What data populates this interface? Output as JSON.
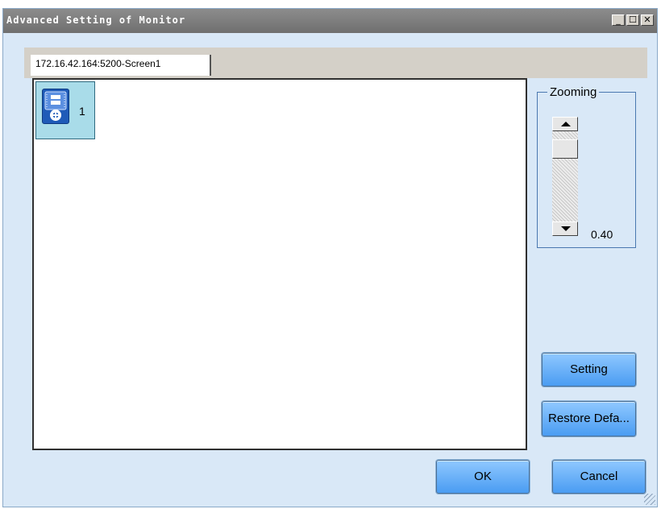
{
  "window": {
    "title": "Advanced Setting of Monitor",
    "controls": {
      "minimize": "_",
      "maximize": "☐",
      "close": "✕"
    }
  },
  "tabs": [
    {
      "label": "172.16.42.164:5200-Screen1",
      "selected": true
    }
  ],
  "screen": {
    "cabinets": [
      {
        "label": "1",
        "icon": "receiving-card-icon"
      }
    ]
  },
  "zoom": {
    "legend": "Zooming",
    "value_text": "0.40",
    "value": 0.4
  },
  "buttons": {
    "setting": "Setting",
    "restore": "Restore Defa...",
    "ok": "OK",
    "cancel": "Cancel"
  },
  "colors": {
    "window_bg": "#d9e8f7",
    "titlebar": "#7a7a7a",
    "button_top": "#8fc8ff",
    "button_bottom": "#4a9cf2",
    "cabinet_bg": "#a9dce9"
  }
}
